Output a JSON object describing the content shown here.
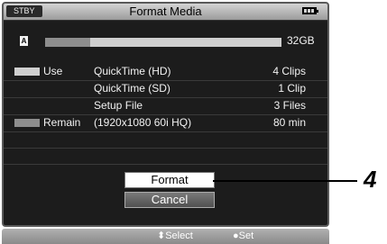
{
  "header": {
    "status": "STBY",
    "title": "Format Media",
    "battery_icon": "battery-icon"
  },
  "media": {
    "slot": "A",
    "capacity": "32GB",
    "used_fraction": 0.19
  },
  "rows": [
    {
      "label": "Use",
      "name": "QuickTime (HD)",
      "value": "4 Clips"
    },
    {
      "label": "",
      "name": "QuickTime (SD)",
      "value": "1 Clip"
    },
    {
      "label": "",
      "name": "Setup File",
      "value": "3 Files"
    },
    {
      "label": "Remain",
      "name": "(1920x1080 60i HQ)",
      "value": "80 min"
    }
  ],
  "buttons": {
    "format": "Format",
    "cancel": "Cancel"
  },
  "footer": {
    "select_hint": "⬍Select",
    "set_hint": "●Set"
  },
  "callout": "4",
  "colors": {
    "use_swatch": "#cfcfcf",
    "remain_swatch": "#8e8e8e"
  }
}
